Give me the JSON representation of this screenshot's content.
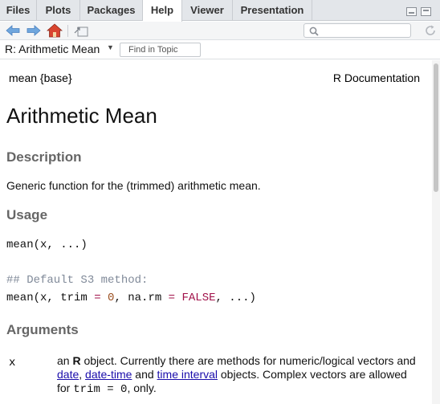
{
  "tabs": [
    "Files",
    "Plots",
    "Packages",
    "Help",
    "Viewer",
    "Presentation"
  ],
  "active_tab": "Help",
  "toolbar": {
    "back_icon": "back-arrow-icon",
    "forward_icon": "forward-arrow-icon",
    "home_icon": "home-icon",
    "popout_icon": "popout-icon",
    "search_icon": "magnifier-icon",
    "refresh_icon": "refresh-icon",
    "search_value": ""
  },
  "topic": {
    "title": "R: Arithmetic Mean",
    "find_placeholder": "Find in Topic"
  },
  "doc": {
    "header_left": "mean {base}",
    "header_right": "R Documentation",
    "title": "Arithmetic Mean",
    "description_heading": "Description",
    "description_text": "Generic function for the (trimmed) arithmetic mean.",
    "usage_heading": "Usage",
    "usage_line1_fn": "mean",
    "usage_line1_args": "(x, ...)",
    "usage_comment": "## Default S3 method:",
    "usage_line2": {
      "fn": "mean",
      "p1": "(x, trim ",
      "eq1": "=",
      "sp1": " ",
      "val1": "0",
      "p2": ", na.rm ",
      "eq2": "=",
      "sp2": " ",
      "val2": "FALSE",
      "p3": ", ...)"
    },
    "arguments_heading": "Arguments",
    "arg_name": "x",
    "arg_desc": {
      "t1": "an ",
      "bold": "R",
      "t2": " object. Currently there are methods for numeric/logical vectors and ",
      "link1": "date",
      "t3": ", ",
      "link2": "date-time",
      "t4": " and ",
      "link3": "time interval",
      "t5": " objects. Complex vectors are allowed for ",
      "code1": "trim = 0",
      "t6": ", only."
    }
  },
  "colors": {
    "heading_gray": "#666666",
    "link": "#1a0dab",
    "code_keyword": "#a1124a",
    "code_comment": "#808a99",
    "home_red": "#c0392b",
    "nav_blue": "#4a90d9"
  }
}
